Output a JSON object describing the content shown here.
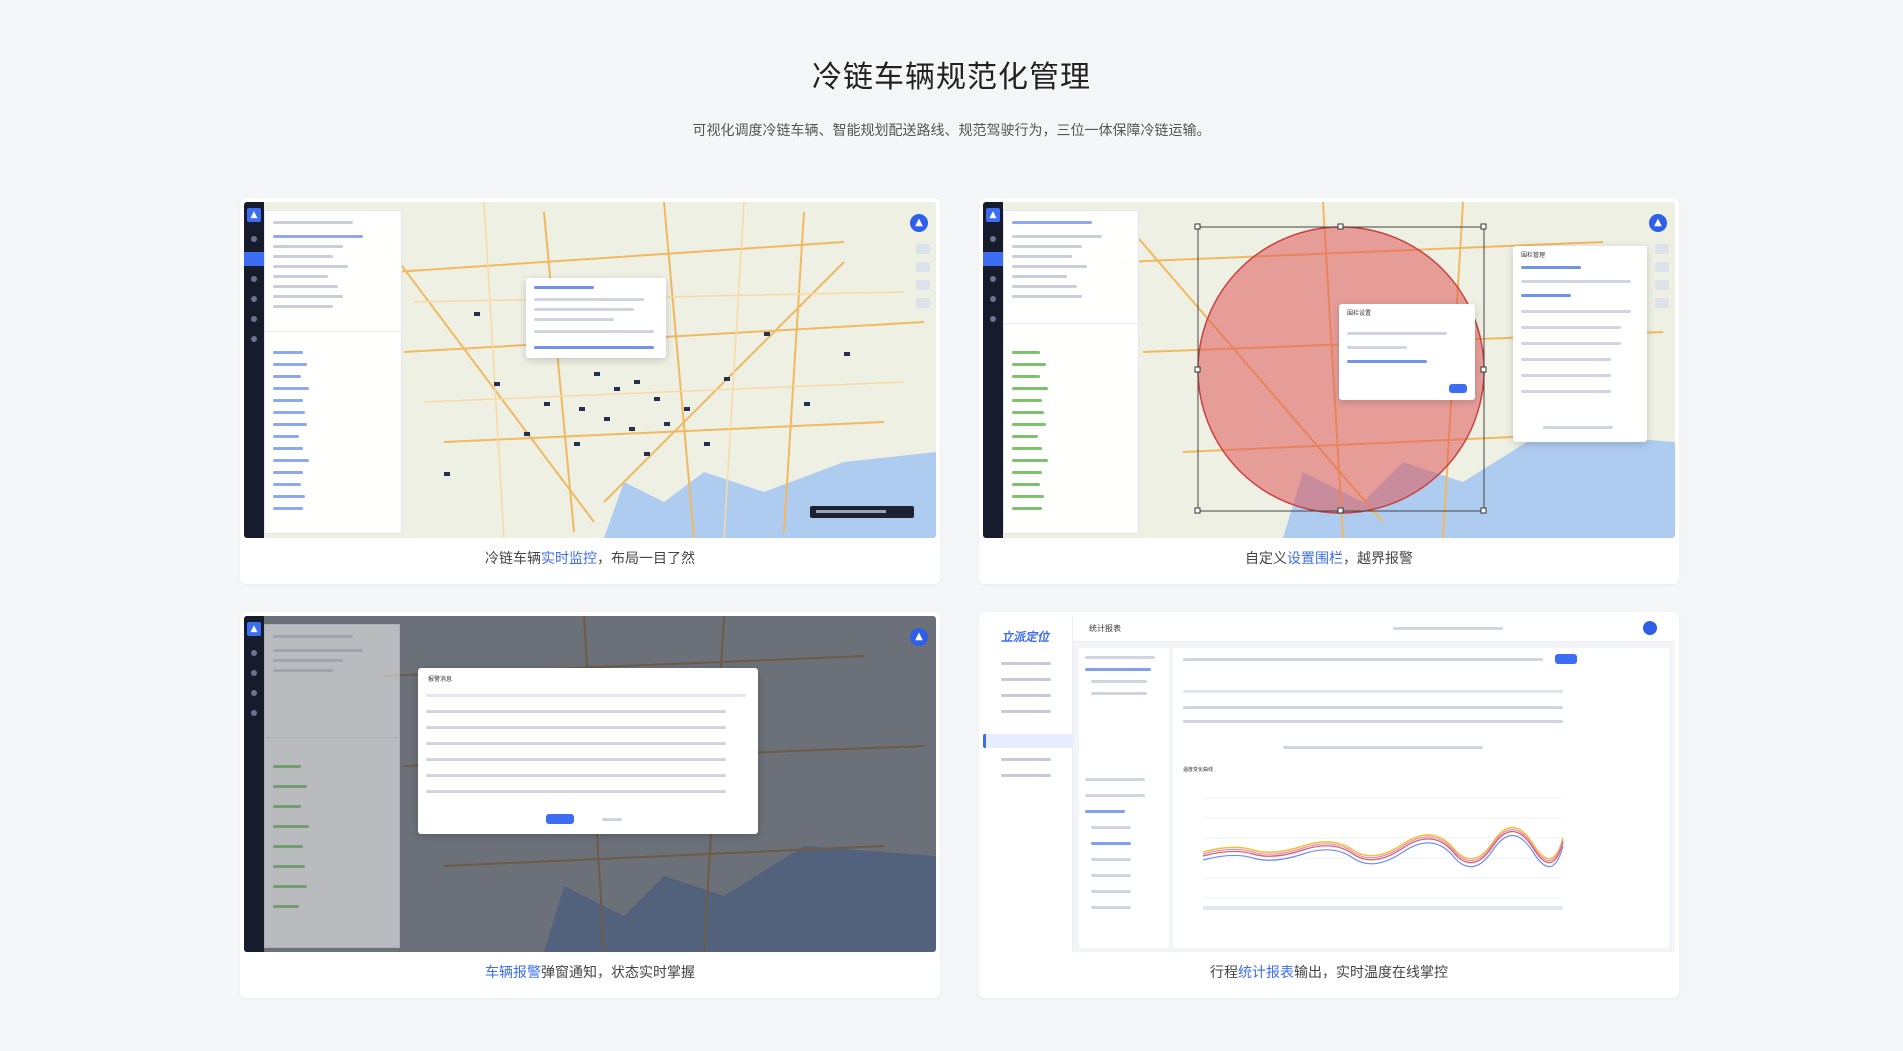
{
  "header": {
    "title": "冷链车辆规范化管理",
    "subtitle": "可视化调度冷链车辆、智能规划配送路线、规范驾驶行为，三位一体保障冷链运输。"
  },
  "cards": [
    {
      "caption_pre": "冷链车辆",
      "caption_highlight": "实时监控",
      "caption_post": "，布局一目了然"
    },
    {
      "caption_pre": "自定义",
      "caption_highlight": "设置围栏",
      "caption_post": "，越界报警"
    },
    {
      "caption_pre": "",
      "caption_highlight": "车辆报警",
      "caption_post": "弹窗通知，状态实时掌握"
    },
    {
      "caption_pre": "行程",
      "caption_highlight": "统计报表",
      "caption_post": "输出，实时温度在线掌控"
    }
  ],
  "screens": {
    "fence_dialog_title": "围栏设置",
    "fence_panel_title": "围栏管理",
    "alarm_dialog_title": "报警消息",
    "report_header": "统计报表",
    "report_brand": "立派定位",
    "report_chart_title": "温度变化曲线"
  },
  "colors": {
    "accent": "#3d6df2",
    "nav_dark": "#161c2c",
    "fence_fill": "#e05a5a",
    "sea": "#aecbf0",
    "land": "#eef0e4"
  }
}
